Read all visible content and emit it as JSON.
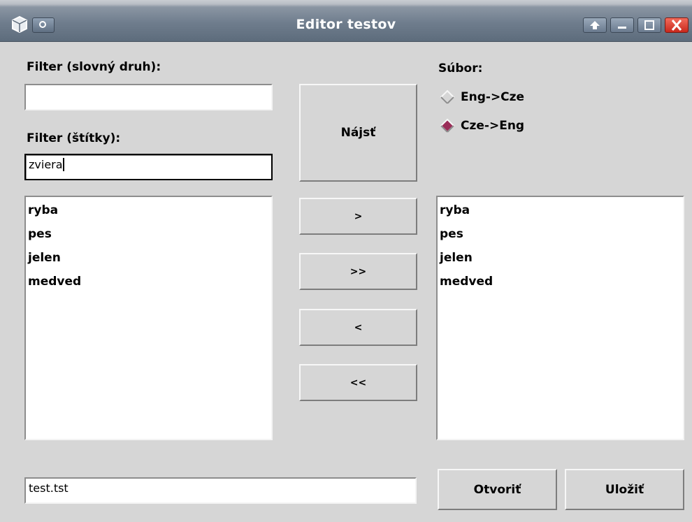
{
  "window": {
    "title": "Editor testov"
  },
  "filters": {
    "pos_label": "Filter (slovný druh):",
    "pos_value": "",
    "tags_label": "Filter (štítky):",
    "tags_value": "zviera"
  },
  "buttons": {
    "find": "Nájsť",
    "move_one_right": ">",
    "move_all_right": ">>",
    "move_one_left": "<",
    "move_all_left": "<<",
    "open": "Otvoriť",
    "save": "Uložiť"
  },
  "file": {
    "label": "Súbor:",
    "direction_options": [
      {
        "label": "Eng->Cze",
        "selected": false
      },
      {
        "label": "Cze->Eng",
        "selected": true
      }
    ],
    "filename": "test.tst"
  },
  "left_list": [
    "ryba",
    "pes",
    "jelen",
    "medved"
  ],
  "right_list": [
    "ryba",
    "pes",
    "jelen",
    "medved"
  ],
  "colors": {
    "radio_selected": "#9a2d58",
    "window_bg": "#d6d6d6",
    "close_button": "#d8382a"
  }
}
